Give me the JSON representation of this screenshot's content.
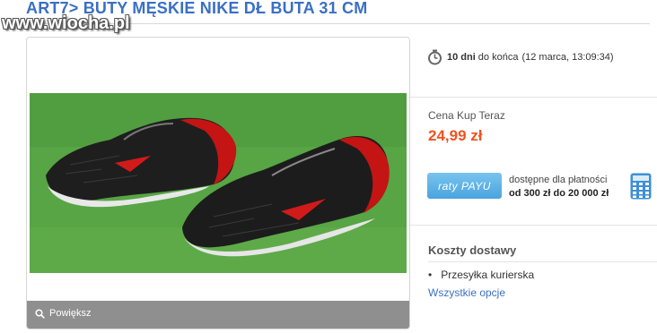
{
  "listing": {
    "title": "ART7> BUTY MĘSKIE NIKE DŁ BUTA 31 CM"
  },
  "watermark": "www.wiocha.pl",
  "gallery": {
    "zoom_label": "Powiększ",
    "photo_icon": "shoes-photo"
  },
  "timer": {
    "icon": "stopwatch-icon",
    "days": "10 dni",
    "rest": "do końca",
    "end_date": "(12 marca, 13:09:34)"
  },
  "price": {
    "label": "Cena Kup Teraz",
    "value": "24,99 zł"
  },
  "installments": {
    "logo_text": "raty PAYU",
    "line1": "dostępne dla płatności",
    "line2": "od 300 zł do 20 000 zł",
    "icon": "calculator-icon"
  },
  "shipping": {
    "heading": "Koszty dostawy",
    "items": [
      "Przesyłka kurierska"
    ],
    "link": "Wszystkie opcje"
  },
  "colors": {
    "title": "#3a6fc4",
    "price": "#f4501e",
    "payu": "#4aa4de",
    "grass": "#4f9e3f"
  }
}
